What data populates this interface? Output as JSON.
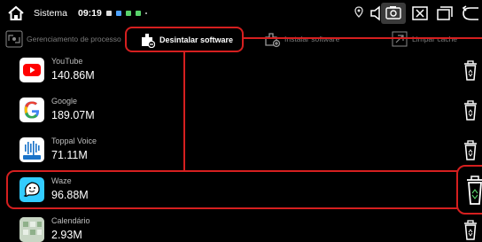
{
  "status_bar": {
    "title": "Sistema",
    "time": "09:19"
  },
  "tabs": [
    {
      "label": "Gerenciamento de processo"
    },
    {
      "label": "Desintalar software"
    },
    {
      "label": "Instalar software"
    },
    {
      "label": "Limpar cache"
    }
  ],
  "apps": [
    {
      "name": "YouTube",
      "size": "140.86M"
    },
    {
      "name": "Google",
      "size": "189.07M"
    },
    {
      "name": "Toppal Voice",
      "size": "71.11M"
    },
    {
      "name": "Waze",
      "size": "96.88M"
    },
    {
      "name": "Calendário",
      "size": "2.93M"
    }
  ],
  "colors": {
    "highlight": "#d51f1f",
    "youtube": "#ff0000",
    "waze": "#33ccff",
    "toppal": "#1a73c9"
  },
  "icon_names": {
    "youtube": "youtube-icon",
    "google": "google-icon",
    "toppal": "toppal-voice-icon",
    "waze": "waze-icon",
    "calendar": "calendar-icon",
    "uninstall": "trash-icon"
  }
}
